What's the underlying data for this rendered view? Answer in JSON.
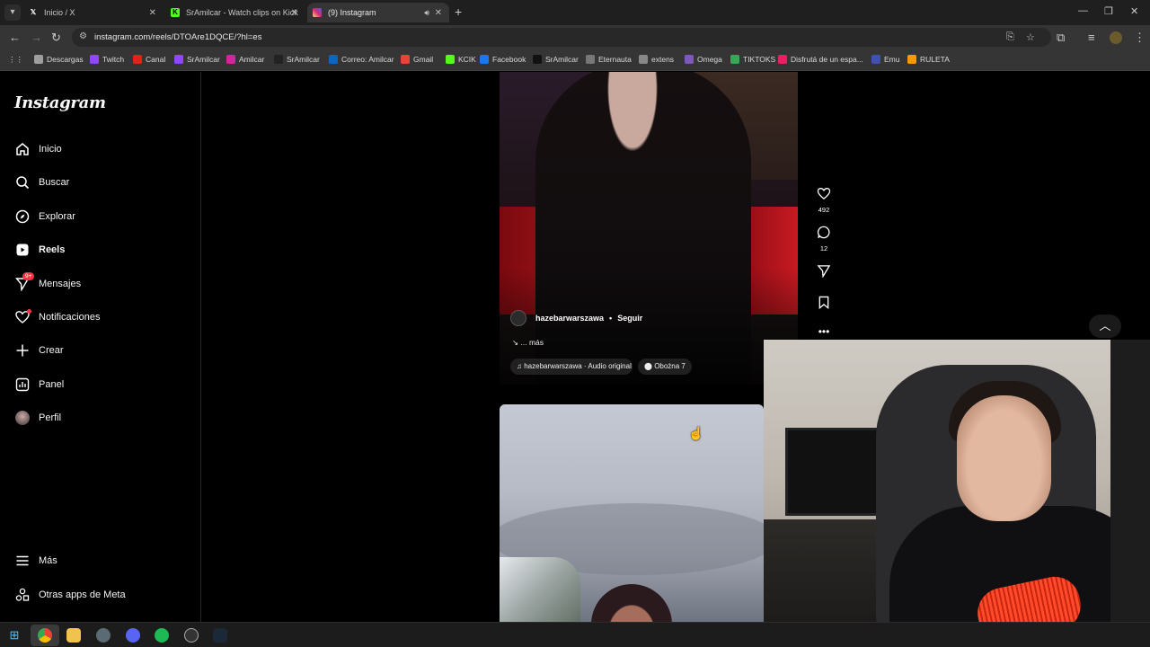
{
  "browser": {
    "tabs": [
      {
        "title": "Inicio / X",
        "icon": "x-logo-icon"
      },
      {
        "title": "SrAmilcar - Watch clips on Kick",
        "icon": "kick-icon"
      },
      {
        "title": "(9) Instagram",
        "icon": "instagram-icon",
        "active": true
      }
    ],
    "url": "instagram.com/reels/DTOAre1DQCE/?hl=es",
    "bookmarks": [
      {
        "label": "Descargas",
        "color": "#9e9e9e"
      },
      {
        "label": "Twitch",
        "color": "#9146ff"
      },
      {
        "label": "Canal",
        "color": "#e62117"
      },
      {
        "label": "SrAmilcar",
        "color": "#9146ff"
      },
      {
        "label": "Amilcar",
        "color": "#d6249f"
      },
      {
        "label": "SrAmilcar",
        "color": "#222222"
      },
      {
        "label": "Correo: Amilcar",
        "color": "#0a66c2"
      },
      {
        "label": "Gmail",
        "color": "#ea4335"
      },
      {
        "label": "KCIK",
        "color": "#53fc18"
      },
      {
        "label": "Facebook",
        "color": "#1877f2"
      },
      {
        "label": "SrAmilcar",
        "color": "#111111"
      },
      {
        "label": "Eternauta",
        "color": "#777777"
      },
      {
        "label": "extens",
        "color": "#888888"
      },
      {
        "label": "Omega",
        "color": "#7e57c2"
      },
      {
        "label": "TIKTOKS",
        "color": "#34a853"
      },
      {
        "label": "Disfrutá de un espa...",
        "color": "#e91e63"
      },
      {
        "label": "Emu",
        "color": "#3f51b5"
      },
      {
        "label": "RULETA",
        "color": "#ff9800"
      }
    ]
  },
  "instagram": {
    "logo": "Instagram",
    "nav": [
      {
        "label": "Inicio",
        "icon": "home-icon"
      },
      {
        "label": "Buscar",
        "icon": "search-icon"
      },
      {
        "label": "Explorar",
        "icon": "compass-icon"
      },
      {
        "label": "Reels",
        "icon": "reels-icon",
        "active": true
      },
      {
        "label": "Mensajes",
        "icon": "messenger-icon",
        "badge": "9+"
      },
      {
        "label": "Notificaciones",
        "icon": "heart-icon"
      },
      {
        "label": "Crear",
        "icon": "plus-icon"
      },
      {
        "label": "Panel",
        "icon": "chart-icon"
      },
      {
        "label": "Perfil",
        "icon": "avatar"
      }
    ],
    "more": [
      {
        "label": "Más",
        "icon": "menu-icon"
      },
      {
        "label": "Otras apps de Meta",
        "icon": "meta-apps-icon"
      }
    ],
    "reel": {
      "username": "hazebarwarszawa",
      "follow": "Seguir",
      "caption": "... más",
      "audio": "hazebarwarszawa · Audio original",
      "location": "Obożna 7",
      "likes": "492",
      "comments": "12"
    }
  }
}
